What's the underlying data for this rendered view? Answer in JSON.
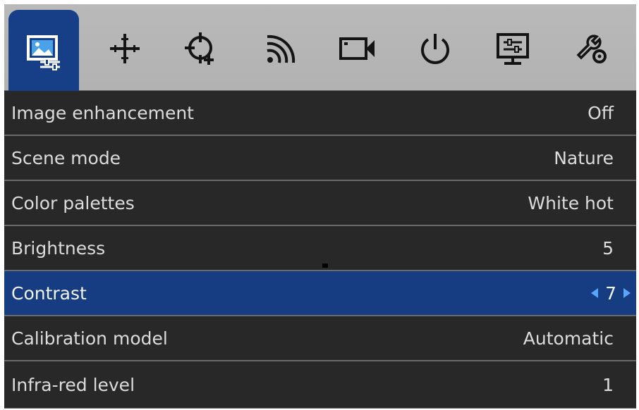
{
  "tabs": [
    {
      "icon": "image-settings-icon",
      "active": true
    },
    {
      "icon": "crosshair-move-icon",
      "active": false
    },
    {
      "icon": "reticle-plus-icon",
      "active": false
    },
    {
      "icon": "wifi-signal-icon",
      "active": false
    },
    {
      "icon": "video-camera-icon",
      "active": false
    },
    {
      "icon": "power-icon",
      "active": false
    },
    {
      "icon": "display-settings-icon",
      "active": false
    },
    {
      "icon": "tools-settings-icon",
      "active": false
    }
  ],
  "menu": {
    "items": [
      {
        "label": "Image enhancement",
        "value": "Off"
      },
      {
        "label": "Scene mode",
        "value": "Nature"
      },
      {
        "label": "Color palettes",
        "value": "White hot"
      },
      {
        "label": "Brightness",
        "value": "5"
      },
      {
        "label": "Contrast",
        "value": "7",
        "selected": true
      },
      {
        "label": "Calibration model",
        "value": "Automatic"
      },
      {
        "label": "Infra-red level",
        "value": "1"
      }
    ]
  },
  "colors": {
    "tab_active": "#163f87",
    "tab_bar": "#b5b5b5",
    "row_bg": "#282828",
    "row_selected": "#163d82",
    "arrow": "#5aa6ff"
  }
}
